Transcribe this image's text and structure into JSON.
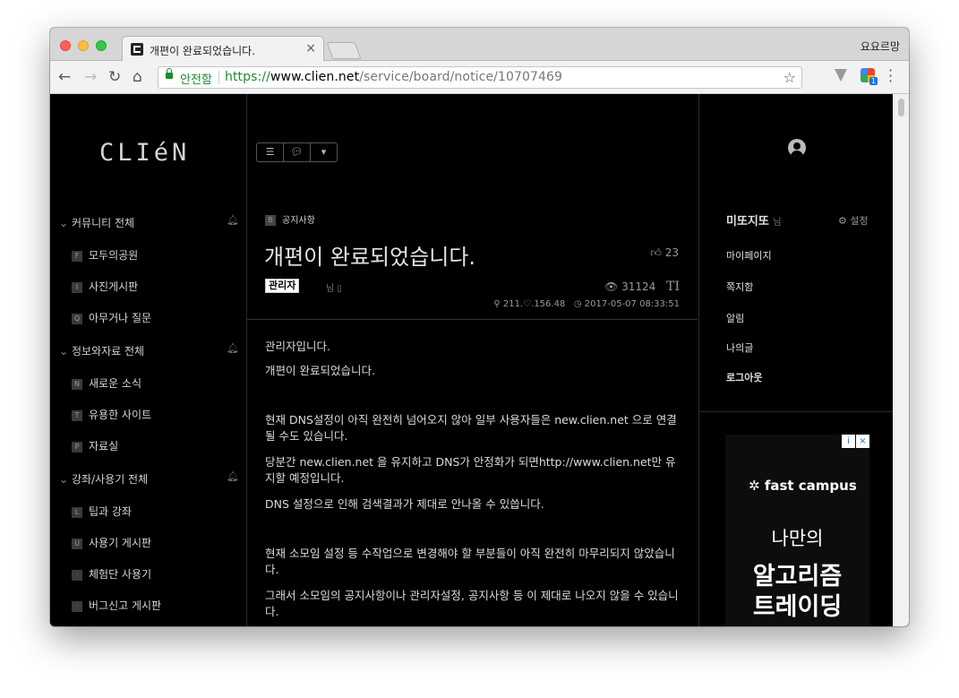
{
  "browser": {
    "tab_title": "개편이 완료되었습니다.",
    "tab_close": "×",
    "profile_name": "요요르망",
    "secure_label": "안전함",
    "url_scheme": "https://",
    "url_host": "www.clien.net",
    "url_path": "/service/board/notice/10707469",
    "ext_badge": "1"
  },
  "site": {
    "logo": "CLIéN"
  },
  "nav": {
    "groups": [
      {
        "label": "커뮤니티 전체",
        "items": [
          {
            "badge": "F",
            "label": "모두의공원"
          },
          {
            "badge": "I",
            "label": "사진게시판"
          },
          {
            "badge": "Q",
            "label": "아무거나 질문"
          }
        ]
      },
      {
        "label": "정보와자료 전체",
        "items": [
          {
            "badge": "N",
            "label": "새로운 소식"
          },
          {
            "badge": "T",
            "label": "유용한 사이트"
          },
          {
            "badge": "P",
            "label": "자료실"
          }
        ]
      },
      {
        "label": "강좌/사용기 전체",
        "items": [
          {
            "badge": "L",
            "label": "팁과 강좌"
          },
          {
            "badge": "U",
            "label": "사용기 게시판"
          },
          {
            "badge": "·",
            "label": "체험단 사용기"
          },
          {
            "badge": "·",
            "label": "버그신고 게시판"
          }
        ]
      }
    ]
  },
  "article": {
    "category_badge": "B",
    "category": "공지사항",
    "title": "개편이 완료되었습니다.",
    "likes": "23",
    "author": "관리자",
    "author_suffix": "님",
    "views": "31124",
    "font_toggle": "TI",
    "ip": "211.♡.156.48",
    "datetime": "2017-05-07 08:33:51",
    "paragraphs": [
      "관리자입니다.",
      "개편이 완료되었습니다.",
      "현재 DNS설정이 아직 완전히 넘어오지 않아 일부 사용자들은 new.clien.net 으로 연결될 수도 있습니다.",
      "당분간 new.clien.net 을 유지하고 DNS가 안정화가 되면http://www.clien.net만 유지할 예정입니다.",
      "DNS 설정으로 인해 검색결과가 제대로 안나올 수 있씁니다.",
      "현재 소모임 설정 등 수작업으로 변경해야 할 부분들이 아직 완전히 마무리되지 않았습니다.",
      "그래서 소모임의 공지사항이나 관리자설정, 공지사항 등 이 제대로 나오지 않을 수 있습니다."
    ]
  },
  "user_panel": {
    "username": "미또지또",
    "username_suffix": "님",
    "settings_label": "설정",
    "menu": [
      "마이페이지",
      "쪽지함",
      "알림",
      "나의글",
      "로그아웃"
    ]
  },
  "ad": {
    "brand": "fast campus",
    "line1": "나만의",
    "line2": "알고리즘",
    "line3": "트레이딩",
    "info": "i",
    "close": "×"
  },
  "colors": {
    "page_bg": "#000000",
    "secure_green": "#1a8b2e",
    "text_light": "#dcdcdc"
  }
}
